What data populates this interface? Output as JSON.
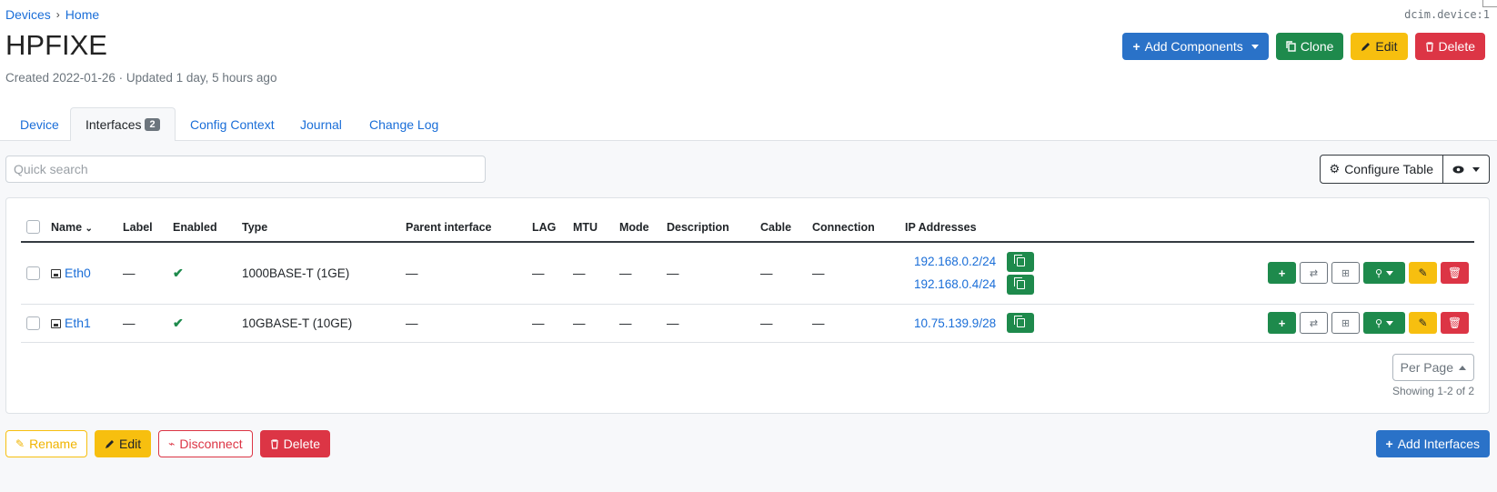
{
  "breadcrumb": {
    "devices": "Devices",
    "home": "Home",
    "separator": "›"
  },
  "object_id": "dcim.device:1",
  "title": "HPFIXE",
  "meta": "Created 2022-01-26 · Updated 1 day, 5 hours ago",
  "header_buttons": {
    "add_components": "Add Components",
    "clone": "Clone",
    "edit": "Edit",
    "delete": "Delete"
  },
  "tabs": [
    {
      "label": "Device"
    },
    {
      "label": "Interfaces",
      "badge": "2"
    },
    {
      "label": "Config Context"
    },
    {
      "label": "Journal"
    },
    {
      "label": "Change Log"
    }
  ],
  "search": {
    "placeholder": "Quick search",
    "value": ""
  },
  "configure_table": "Configure Table",
  "table": {
    "columns": [
      "Name",
      "Label",
      "Enabled",
      "Type",
      "Parent interface",
      "LAG",
      "MTU",
      "Mode",
      "Description",
      "Cable",
      "Connection",
      "IP Addresses"
    ],
    "sort_indicator": "⌄",
    "rows": [
      {
        "name": "Eth0",
        "label": "—",
        "enabled": "✔",
        "type": "1000BASE-T (1GE)",
        "parent": "—",
        "lag": "—",
        "mtu": "—",
        "mode": "—",
        "description": "—",
        "cable": "—",
        "connection": "—",
        "ips": [
          "192.168.0.2/24",
          "192.168.0.4/24"
        ]
      },
      {
        "name": "Eth1",
        "label": "—",
        "enabled": "✔",
        "type": "10GBASE-T (10GE)",
        "parent": "—",
        "lag": "—",
        "mtu": "—",
        "mode": "—",
        "description": "—",
        "cable": "—",
        "connection": "—",
        "ips": [
          "10.75.139.9/28"
        ]
      }
    ]
  },
  "per_page": "Per Page",
  "showing": "Showing 1-2 of 2",
  "bottom_buttons": {
    "rename": "Rename",
    "edit": "Edit",
    "disconnect": "Disconnect",
    "delete": "Delete",
    "add_interfaces": "Add Interfaces"
  },
  "colors": {
    "primary": "#2a72c8",
    "success": "#1e8a4c",
    "warning": "#f7bf0f",
    "danger": "#dc3545",
    "link": "#1a6ed8"
  },
  "icons": {
    "add": "+",
    "check": "✔",
    "delete": "trash-icon",
    "edit": "pencil-icon",
    "clone": "copy-icon",
    "settings": "gear-icon",
    "eye": "eye-icon",
    "disconnect": "unplug-icon"
  }
}
